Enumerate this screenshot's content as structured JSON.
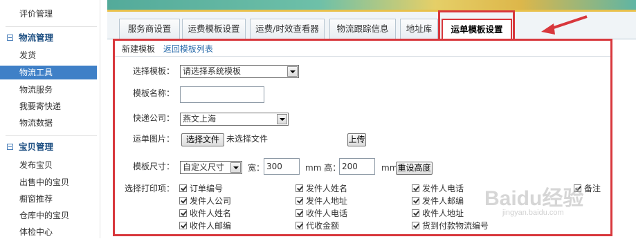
{
  "sidebar": {
    "top_items": [
      "评价管理"
    ],
    "logistics_title": "物流管理",
    "logistics_items": [
      "发货",
      "物流工具",
      "物流服务",
      "我要寄快递",
      "物流数据"
    ],
    "baby_title": "宝贝管理",
    "baby_items": [
      "发布宝贝",
      "出售中的宝贝",
      "橱窗推荐",
      "仓库中的宝贝",
      "体检中心"
    ]
  },
  "tabs": [
    "服务商设置",
    "运费模板设置",
    "运费/时效查看器",
    "物流跟踪信息",
    "地址库",
    "运单模板设置"
  ],
  "subnav": {
    "new_template": "新建模板",
    "back_to_list": "返回模板列表"
  },
  "form": {
    "select_template_label": "选择模板：",
    "select_template_value": "请选择系统模板",
    "template_name_label": "模板名称：",
    "template_name_value": "",
    "courier_label": "快递公司：",
    "courier_value": "燕文上海",
    "waybill_image_label": "运单图片：",
    "choose_file_button": "选择文件",
    "no_file_text": "未选择文件",
    "upload_button": "上传",
    "size_label": "模板尺寸：",
    "size_value": "自定义尺寸",
    "width_label": "宽：",
    "width_value": "300",
    "mm_height_label": "mm 高：",
    "height_value": "200",
    "mm_label": "mm",
    "reset_height_button": "重设高度",
    "print_items_label": "选择打印项："
  },
  "print_items": {
    "col1": [
      "订单编号",
      "发件人公司",
      "收件人姓名",
      "收件人邮编"
    ],
    "col2": [
      "发件人姓名",
      "发件人地址",
      "收件人电话",
      "代收金额"
    ],
    "col3": [
      "发件人电话",
      "发件人邮编",
      "收件人地址",
      "货到付款物流编号"
    ],
    "col4": [
      "备注"
    ]
  },
  "watermark": {
    "logo": "Baidu经验",
    "url": "jingyan.baidu.com"
  },
  "colors": {
    "accent_red": "#d8373c",
    "sidebar_active": "#3f80c7",
    "link_blue": "#2669a9"
  }
}
